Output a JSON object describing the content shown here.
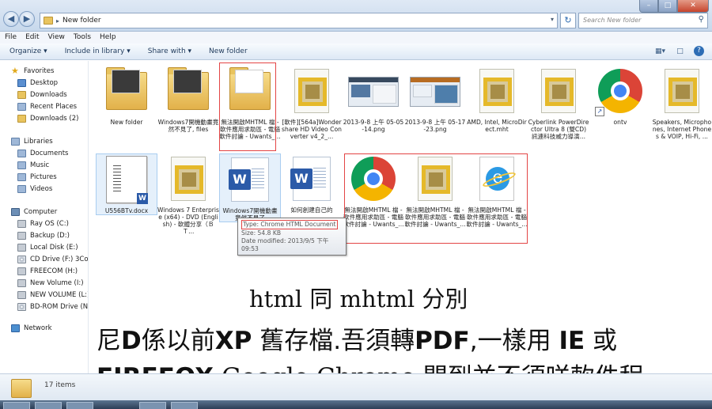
{
  "window": {
    "address_path": "New folder",
    "search_placeholder": "Search New folder",
    "colors": {
      "titlebar": "#c7d8ec",
      "selection": "#e5f0fb",
      "highlight_box": "#e34545"
    }
  },
  "menu": [
    "File",
    "Edit",
    "View",
    "Tools",
    "Help"
  ],
  "toolbar": {
    "organize": "Organize ▾",
    "include": "Include in library ▾",
    "share": "Share with ▾",
    "new_folder": "New folder"
  },
  "nav": {
    "favorites": "Favorites",
    "fav_items": [
      "Desktop",
      "Downloads",
      "Recent Places",
      "Downloads (2)"
    ],
    "libraries": "Libraries",
    "lib_items": [
      "Documents",
      "Music",
      "Pictures",
      "Videos"
    ],
    "computer": "Computer",
    "comp_items": [
      "Ray OS (C:)",
      "Backup (D:)",
      "Local Disk (E:)",
      "CD Drive (F:) 3Conne",
      "FREECOM (H:)",
      "New Volume (I:)",
      "NEW VOLUME (L:)",
      "BD-ROM Drive (N:) I"
    ],
    "network": "Network"
  },
  "files": [
    {
      "name": "New folder",
      "icon": "folder-icon"
    },
    {
      "name": "Windows7開機動畫竟然不見了, files",
      "icon": "folder-icon"
    },
    {
      "name": "無法開啟MHTML 檔 - 軟件應用求助區 - 電腦軟件討論 - Uwants_...",
      "icon": "folder-icon"
    },
    {
      "name": "[軟件][564a]Wondershare HD Video Converter v4_2_...",
      "icon": "mhtml-icon"
    },
    {
      "name": "2013-9-8 上午 05-05-14.png",
      "icon": "image-icon"
    },
    {
      "name": "2013-9-8 上午 05-17-23.png",
      "icon": "image-icon"
    },
    {
      "name": "AMD, Intel, MicroDirect.mht",
      "icon": "mhtml-icon"
    },
    {
      "name": "Cyberlink PowerDirector Ultra 8 (雙CD) 訊連科技威力導演...",
      "icon": "mhtml-icon"
    },
    {
      "name": "ontv",
      "icon": "chrome-icon"
    },
    {
      "name": "Speakers, Microphones, Internet Phones & VOIP, Hi-Fi, ...",
      "icon": "mhtml-icon"
    },
    {
      "name": "U556BTv.docx",
      "icon": "word-doc-icon"
    },
    {
      "name": "Windows 7 Enterprise (x64) - DVD (English) - 軟體分享（ＢＴ...",
      "icon": "mhtml-icon"
    },
    {
      "name": "Windows7開機動畫竟然不見了",
      "icon": "word-html-icon"
    },
    {
      "name": "如何創建自己的",
      "icon": "word-html-icon"
    },
    {
      "name": "無法開啟MHTML 檔 - 軟件應用求助區 - 電腦軟件討論 - Uwants_...",
      "icon": "chrome-icon"
    },
    {
      "name": "無法開啟MHTML 檔 - 軟件應用求助區 - 電腦軟件討論 - Uwants_...",
      "icon": "mhtml-icon"
    },
    {
      "name": "無法開啟MHTML 檔 - 軟件應用求助區 - 電腦軟件討論 - Uwants_...",
      "icon": "ie-icon"
    }
  ],
  "tooltip": {
    "type": "Type: Chrome HTML Document",
    "size": "Size: 54.8 KB",
    "modified": "Date modified: 2013/9/5 下午 09:53"
  },
  "captions": {
    "line1": "html 同  mhtml 分別",
    "line2_a": "尼",
    "line2_b": "D",
    "line2_c": "係以前",
    "line2_d": "XP",
    "line2_e": " 舊存檔.吾須轉",
    "line2_f": "PDF",
    "line2_g": ",一樣用 ",
    "line2_h": "IE",
    "line2_i": " 或",
    "line3_a": "FIREFOX",
    "line3_b": " Google Chrome 開到並不須咩軟件程"
  },
  "status": {
    "count": "17 items"
  }
}
